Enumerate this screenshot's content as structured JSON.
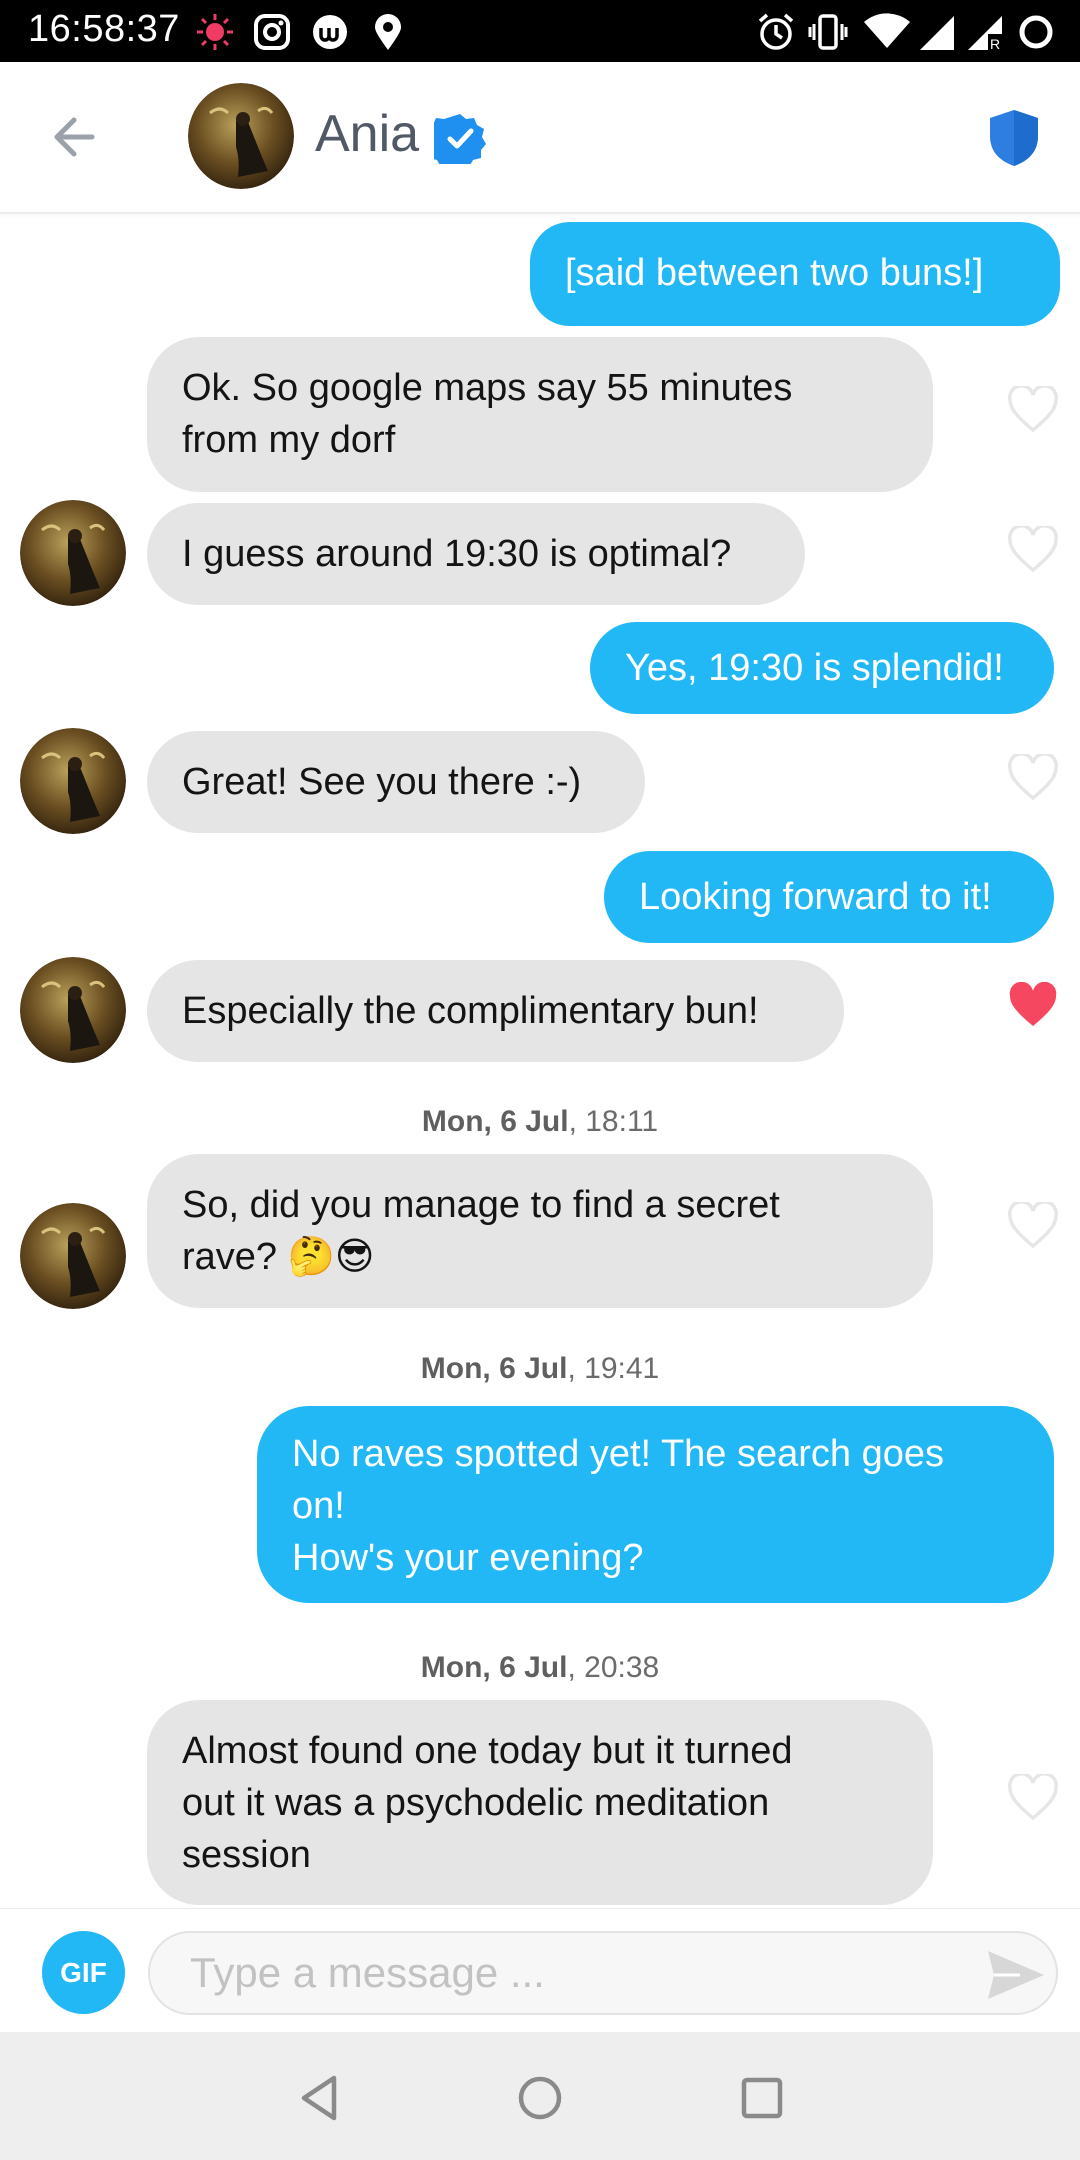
{
  "status_bar": {
    "time": "16:58:37",
    "icons": [
      "record-icon",
      "instagram-icon",
      "app-icon",
      "location-icon",
      "alarm-icon",
      "vibrate-icon",
      "wifi-icon",
      "signal-icon",
      "signal-roaming-icon",
      "battery-icon"
    ]
  },
  "header": {
    "name": "Ania",
    "verified": true,
    "back_icon": "back-arrow-icon",
    "shield_icon": "shield-icon"
  },
  "colors": {
    "accent": "#22b8f6",
    "incoming_bubble": "#e5e5e5",
    "heart_liked": "#f5475f",
    "heart_empty": "#e6e6e6"
  },
  "messages": [
    {
      "text": "[said between two buns!]"
    },
    {
      "text": "Ok. So google maps say 55 minutes\nfrom my dorf",
      "liked": false
    },
    {
      "text": "I guess around 19:30 is optimal?",
      "liked": false
    },
    {
      "text": "Yes, 19:30 is splendid!"
    },
    {
      "text": "Great! See you there :-)",
      "liked": false
    },
    {
      "text": "Looking forward to it!"
    },
    {
      "text": "Especially the complimentary bun!",
      "liked": true
    },
    {
      "text": "So, did you manage to find a secret\nrave? 🤔😎",
      "liked": false
    },
    {
      "text": "No raves spotted yet! The search goes\non!\nHow's your evening?"
    },
    {
      "text": "Almost found one today but it turned\nout it was a psychodelic meditation\nsession",
      "liked": false
    }
  ],
  "dates": [
    {
      "day": "Mon, 6 Jul",
      "time": ", 18:11"
    },
    {
      "day": "Mon, 6 Jul",
      "time": ", 19:41"
    },
    {
      "day": "Mon, 6 Jul",
      "time": ", 20:38"
    }
  ],
  "composer": {
    "gif_label": "GIF",
    "placeholder": "Type a message ...",
    "send_icon": "send-icon"
  },
  "nav": {
    "icons": [
      "back-triangle-icon",
      "home-circle-icon",
      "recents-square-icon"
    ]
  }
}
